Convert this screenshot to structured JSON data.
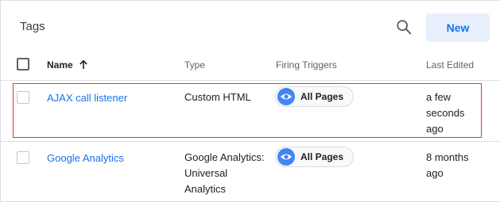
{
  "header": {
    "title": "Tags",
    "new_label": "New"
  },
  "table": {
    "columns": {
      "name": "Name",
      "type": "Type",
      "triggers": "Firing Triggers",
      "edited": "Last Edited"
    },
    "rows": [
      {
        "name": "AJAX call listener",
        "type": [
          "Custom HTML"
        ],
        "trigger": "All Pages",
        "edited": [
          "a few",
          "seconds",
          "ago"
        ]
      },
      {
        "name": "Google Analytics",
        "type": [
          "Google Analytics:",
          "Universal",
          "Analytics"
        ],
        "trigger": "All Pages",
        "edited": [
          "8 months",
          "ago"
        ]
      }
    ]
  },
  "icons": {
    "search": "search-icon",
    "sort": "arrow-up-icon",
    "trigger": "eye-icon"
  },
  "colors": {
    "accent": "#1a73e8",
    "new_button_bg": "#e8f0fe",
    "trigger_icon": "#4285f4",
    "highlight_border": "#e53935"
  }
}
